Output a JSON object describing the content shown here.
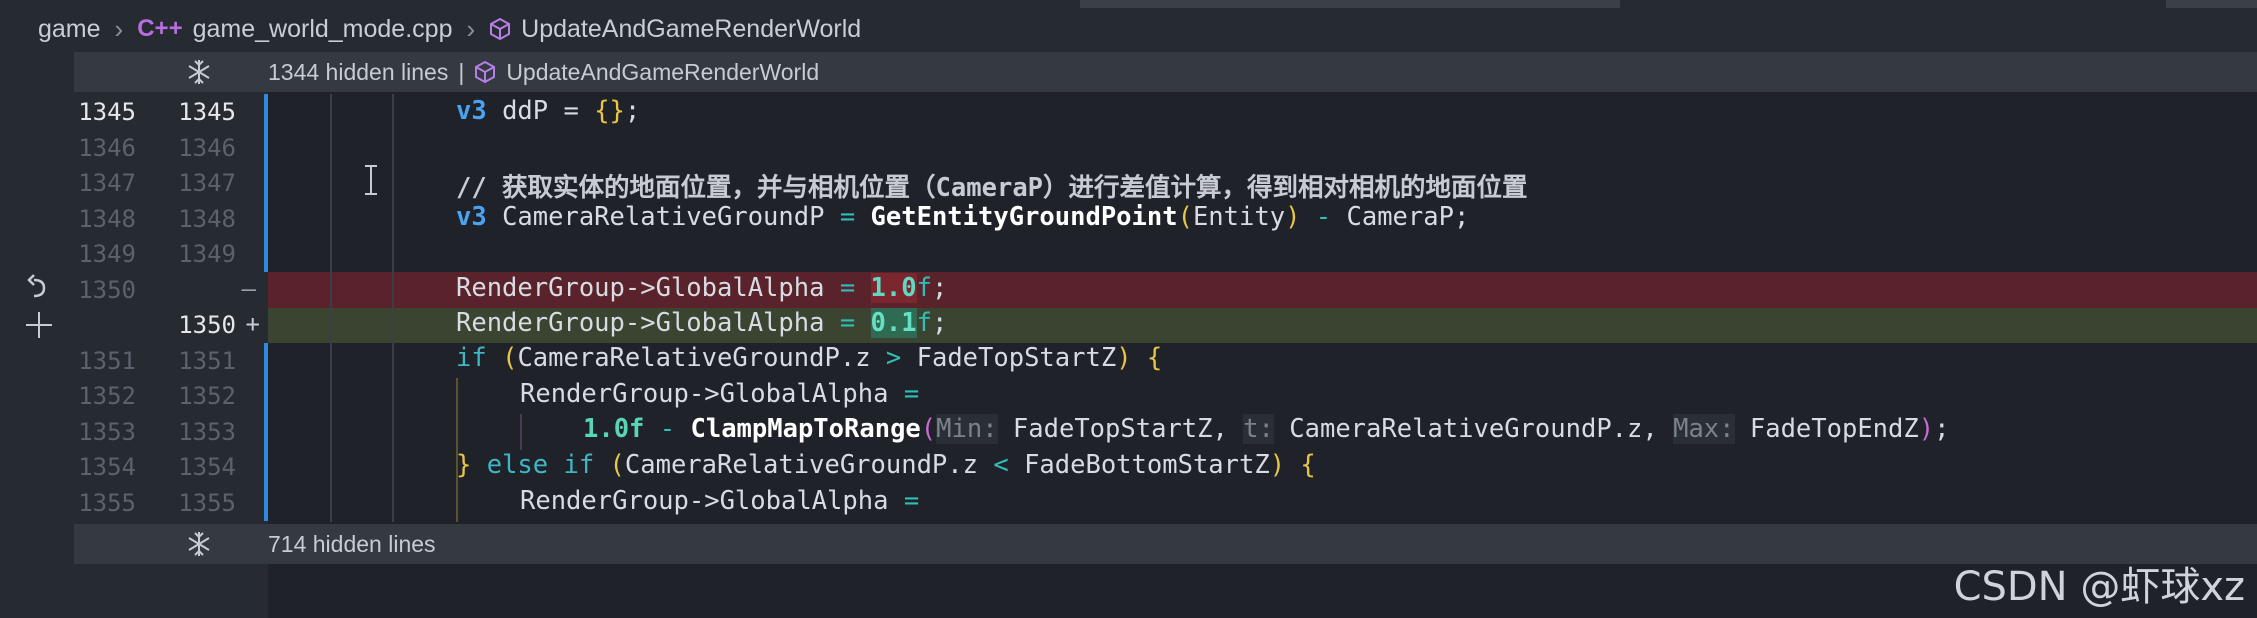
{
  "breadcrumb": {
    "items": [
      "game",
      "game_world_mode.cpp",
      "UpdateAndGameRenderWorld"
    ],
    "file_icon_text": "C++"
  },
  "fold_top": {
    "text": "1344 hidden lines",
    "separator": "|",
    "symbol": "UpdateAndGameRenderWorld"
  },
  "fold_bottom": {
    "text": "714 hidden lines"
  },
  "line_numbers": [
    {
      "old": "1345",
      "new": "1345"
    },
    {
      "old": "1346",
      "new": "1346"
    },
    {
      "old": "1347",
      "new": "1347"
    },
    {
      "old": "1348",
      "new": "1348"
    },
    {
      "old": "1349",
      "new": "1349"
    },
    {
      "old": "1350",
      "new": ""
    },
    {
      "old": "",
      "new": "1350"
    },
    {
      "old": "1351",
      "new": "1351"
    },
    {
      "old": "1352",
      "new": "1352"
    },
    {
      "old": "1353",
      "new": "1353"
    },
    {
      "old": "1354",
      "new": "1354"
    },
    {
      "old": "1355",
      "new": "1355"
    }
  ],
  "diff_markers": {
    "removed": "—",
    "added": "+"
  },
  "code": {
    "l1345": {
      "kw": "v3",
      "rest": " ddP = ",
      "open": "{",
      "close": "}",
      "end": ";"
    },
    "l1347": "// 获取实体的地面位置，并与相机位置（CameraP）进行差值计算，得到相对相机的地面位置",
    "l1348": {
      "kw": "v3",
      "var": " CameraRelativeGroundP ",
      "eq": "=",
      "fn": "GetEntityGroundPoint",
      "open": "(",
      "arg": "Entity",
      "close": ")",
      "minus": " - ",
      "rest": "CameraP;"
    },
    "l1350_old": {
      "lhs": "RenderGroup->GlobalAlpha ",
      "eq": "=",
      "sp": " ",
      "num": "1.0",
      "suffix": "f",
      "end": ";"
    },
    "l1350_new": {
      "lhs": "RenderGroup->GlobalAlpha ",
      "eq": "=",
      "sp": " ",
      "num": "0.1",
      "suffix": "f",
      "end": ";"
    },
    "l1351": {
      "kw": "if",
      "sp": " ",
      "open": "(",
      "a": "CameraRelativeGroundP.z ",
      "op": ">",
      "b": " FadeTopStartZ",
      "close": ")",
      "brace": " {"
    },
    "l1352": {
      "lhs": "RenderGroup->GlobalAlpha ",
      "eq": "="
    },
    "l1353": {
      "num": "1.0f",
      "minus": " - ",
      "fn": "ClampMapToRange",
      "open": "(",
      "h1": "Min:",
      "a1": " FadeTopStartZ, ",
      "h2": "t:",
      "a2": " CameraRelativeGroundP.z, ",
      "h3": "Max:",
      "a3": " FadeTopEndZ",
      "close": ")",
      "end": ";"
    },
    "l1354": {
      "brace": "}",
      "kw": " else if ",
      "open": "(",
      "a": "CameraRelativeGroundP.z ",
      "op": "<",
      "b": " FadeBottomStartZ",
      "close": ")",
      "brace2": " {"
    },
    "l1355": {
      "lhs": "RenderGroup->GlobalAlpha ",
      "eq": "="
    }
  },
  "watermark": "CSDN @虾球xz",
  "icons": [
    "chevron-right-icon",
    "cpp-file-icon",
    "symbol-cube-icon",
    "unfold-icon",
    "revert-icon",
    "plus-icon",
    "text-cursor-icon"
  ]
}
